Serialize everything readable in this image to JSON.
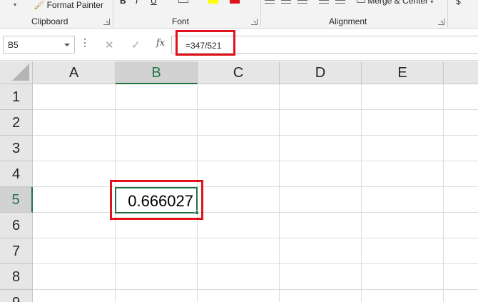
{
  "ribbon": {
    "format_painter": "Format Painter",
    "clipboard_group": "Clipboard",
    "font_group": "Font",
    "alignment_group": "Alignment",
    "merge_center": "Merge & Center",
    "bold": "B",
    "italic": "I",
    "underline": "U",
    "currency": "$"
  },
  "formula_bar": {
    "name_box": "B5",
    "cancel_icon": "✕",
    "enter_icon": "✓",
    "fx_label": "fx",
    "formula": "=347/521"
  },
  "grid": {
    "columns": [
      "A",
      "B",
      "C",
      "D",
      "E"
    ],
    "rows": [
      "1",
      "2",
      "3",
      "4",
      "5",
      "6",
      "7",
      "8",
      "9"
    ],
    "selected_column": "B",
    "selected_row": "5",
    "selected_cell_value": "0.666027"
  },
  "colors": {
    "accent": "#217346",
    "highlight": "#e0121b"
  }
}
